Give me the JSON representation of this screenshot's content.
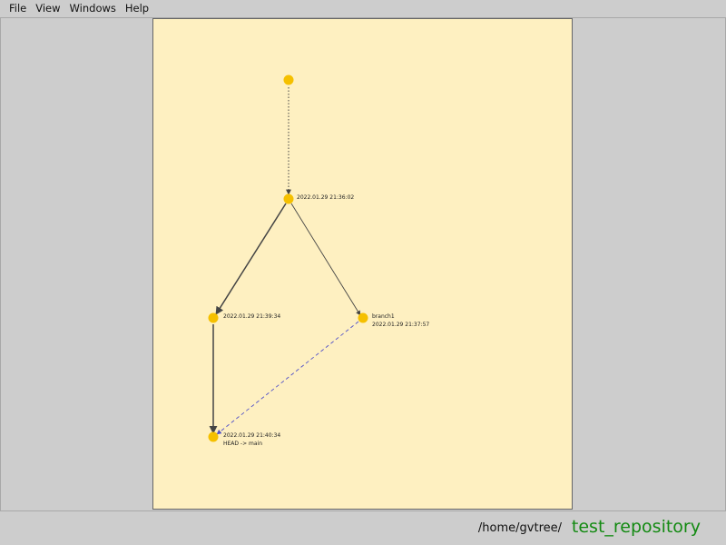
{
  "menu": {
    "items": [
      "File",
      "View",
      "Windows",
      "Help"
    ]
  },
  "graph": {
    "node_color": "#f5c000",
    "edge_color": "#444444",
    "dashed_edge_color": "#5050c8",
    "nodes": [
      {
        "id": "root",
        "labels": []
      },
      {
        "id": "c1",
        "labels": [
          "2022.01.29 21:36:02"
        ]
      },
      {
        "id": "c2",
        "labels": [
          "2022.01.29 21:39:34"
        ]
      },
      {
        "id": "c3",
        "labels": [
          "branch1",
          "2022.01.29 21:37:57"
        ]
      },
      {
        "id": "c4",
        "labels": [
          "2022.01.29 21:40:34",
          "HEAD -> main"
        ]
      }
    ],
    "edges": [
      {
        "from": "root",
        "to": "c1",
        "style": "dotted"
      },
      {
        "from": "c1",
        "to": "c2",
        "style": "solid"
      },
      {
        "from": "c1",
        "to": "c3",
        "style": "solid"
      },
      {
        "from": "c2",
        "to": "c4",
        "style": "solid"
      },
      {
        "from": "c3",
        "to": "c4",
        "style": "dashed"
      }
    ]
  },
  "status": {
    "path": "/home/gvtree/",
    "repo_name": "test_repository",
    "repo_color": "#138a12"
  }
}
